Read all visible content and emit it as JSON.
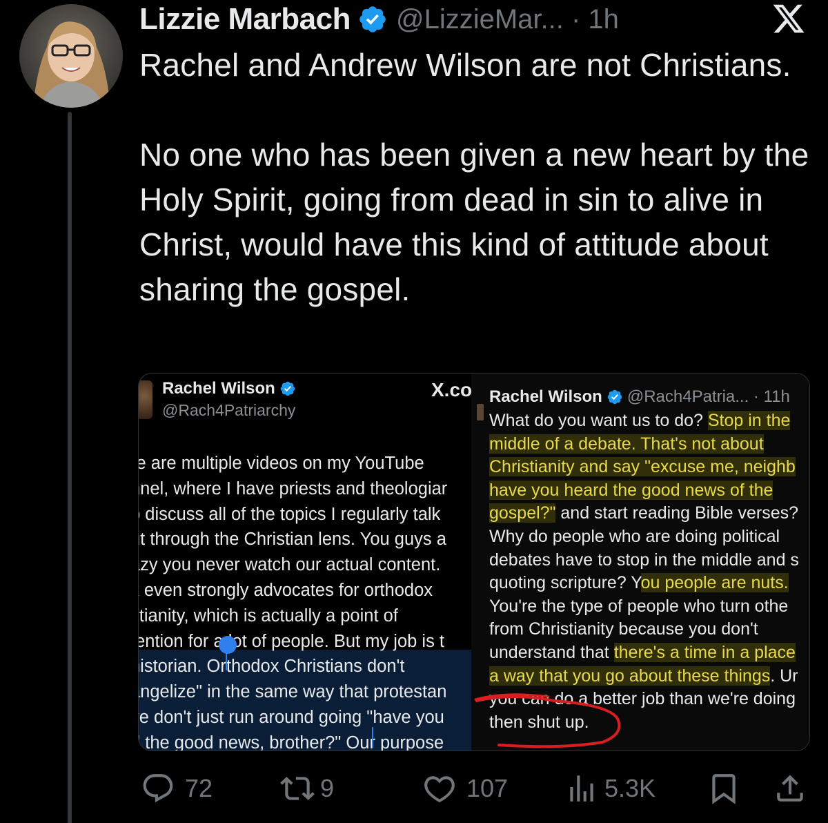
{
  "author": {
    "name": "Lizzie Marbach",
    "handle_meta": "@LizzieMar... · 1h"
  },
  "tweet": {
    "paragraph1": "Rachel and Andrew Wilson are not Christians.",
    "paragraph2": "No one who has been given a new heart by the Holy Spirit, going from dead in sin to alive in Christ, would have this kind of attitude about sharing the gospel."
  },
  "left_screenshot": {
    "name": "Rachel Wilson",
    "handle": "@Rach4Patriarchy",
    "x_label": "X.co",
    "lines": [
      "re are multiple videos on my YouTube",
      "nnel, where I have priests and theologiar",
      "o discuss all of the topics I regularly talk",
      "ut through the Christian lens. You guys a",
      "azy you never watch our actual content.",
      "k even strongly advocates for orthodox",
      "stianity, which is actually a point of",
      "tention for a lot of people. But my job is t",
      " historian. Orthodox Christians don't",
      "angelize\" in the same way that protestan",
      "ve don't just run around going \"have you",
      "d the good news, brother?\" Our purpose"
    ]
  },
  "right_screenshot": {
    "name": "Rachel Wilson",
    "meta": "@Rach4Patria... · 11h",
    "lines": [
      {
        "plain": "What do you want us to do? ",
        "hl": "Stop in the"
      },
      {
        "plain": "",
        "hl": "middle of a debate. That's not about"
      },
      {
        "plain": "",
        "hl": "Christianity and say \"excuse me, neighb"
      },
      {
        "plain": "",
        "hl": "have you heard the good news of the"
      },
      {
        "plain": "",
        "hl": "gospel?\"",
        "after": " and start reading Bible verses?"
      },
      {
        "plain": "Why do people who are doing political",
        "hl": ""
      },
      {
        "plain": "debates have to stop in the middle and s",
        "hl": ""
      },
      {
        "plain": "quoting scripture? Y",
        "hl": "ou people are nuts."
      },
      {
        "plain": "You're the type of people who turn othe",
        "hl": ""
      },
      {
        "plain": "from Christianity because you don't",
        "hl": ""
      },
      {
        "plain": "understand that ",
        "hl": "there's a time in a place"
      },
      {
        "plain": "",
        "hl": "a way that you go about these things",
        "after": ". Ur"
      },
      {
        "plain": "you can do a better job than we're doing",
        "hl": ""
      },
      {
        "plain": "then shut up.",
        "hl": ""
      }
    ]
  },
  "actions": {
    "replies": "72",
    "reposts": "9",
    "likes": "107",
    "views": "5.3K"
  },
  "colors": {
    "background": "#000000",
    "text": "#e7e9ea",
    "muted": "#71767b",
    "verified": "#1d9bf0",
    "highlight": "#e8d94a",
    "annotation_red": "#d81e1e"
  }
}
